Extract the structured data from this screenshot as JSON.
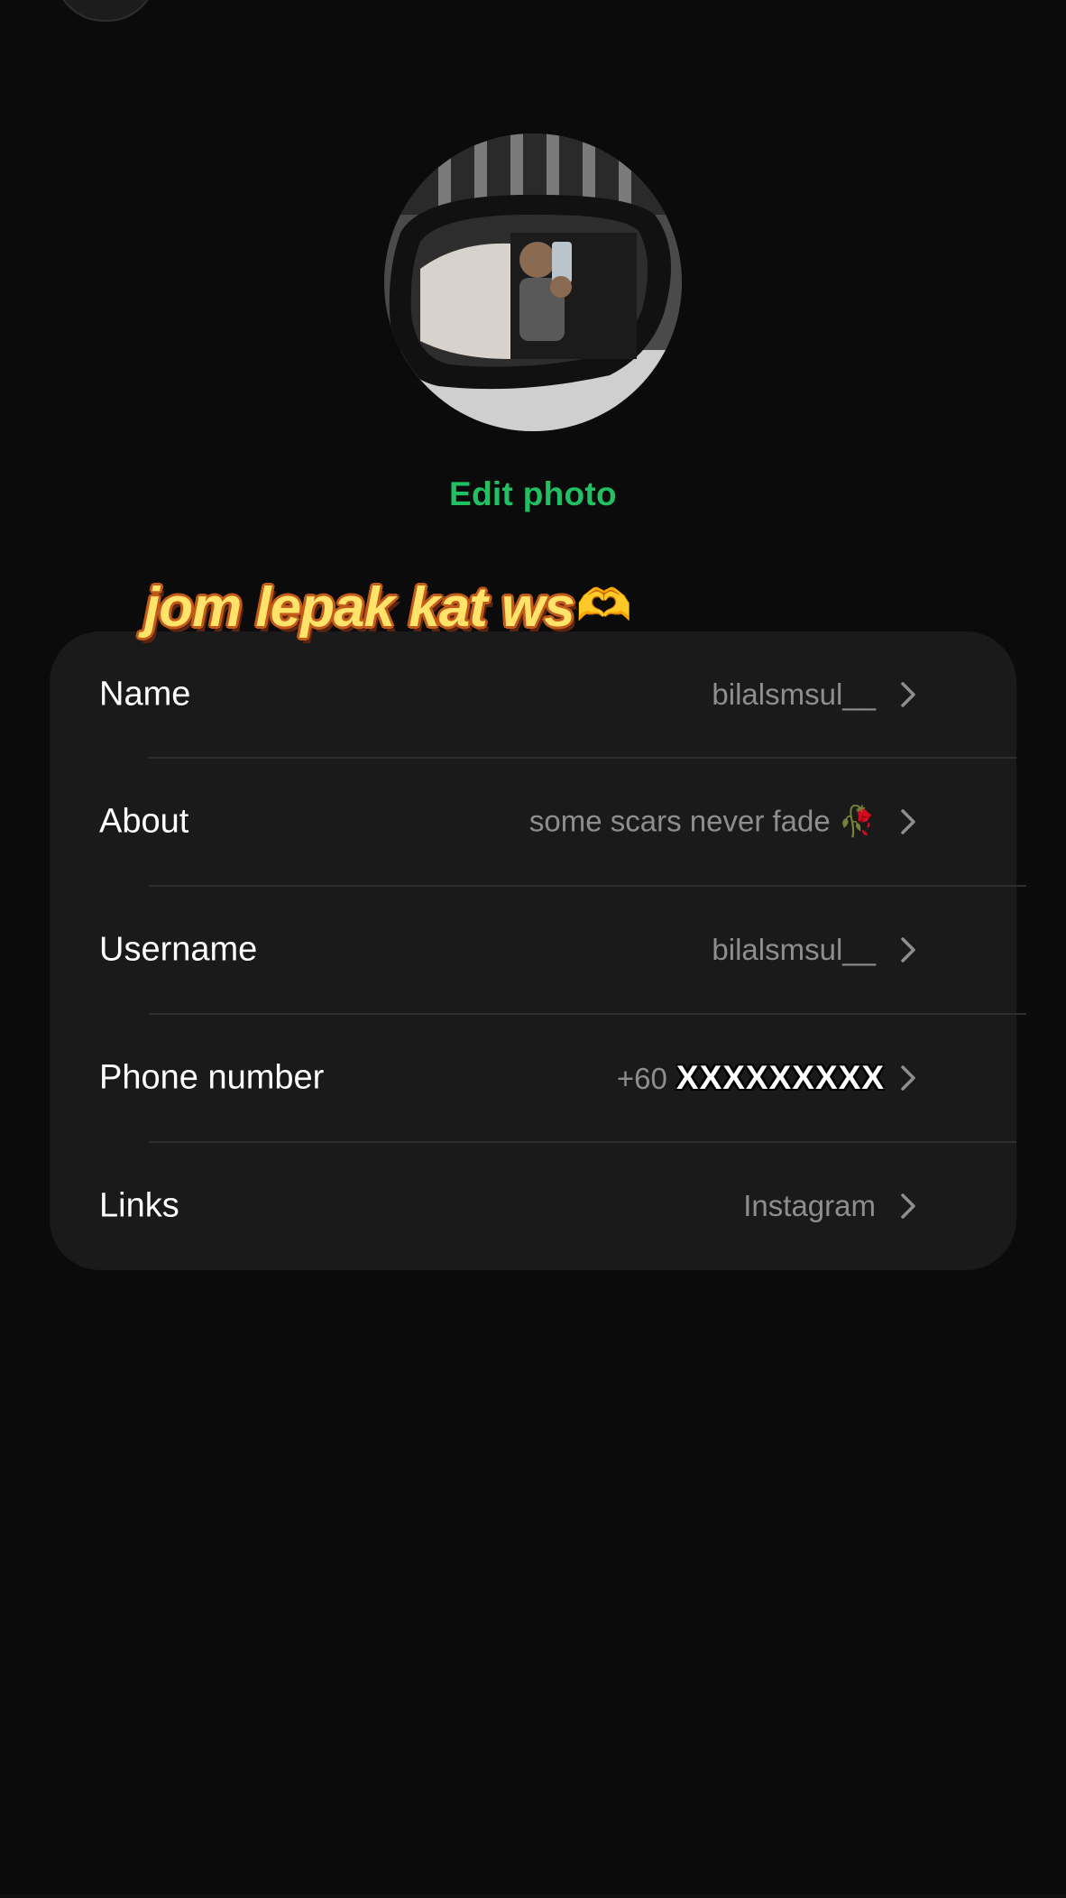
{
  "profile": {
    "edit_photo_label": "Edit photo",
    "sticker_text": "jom lepak kat ws",
    "sticker_emoji": "🫶"
  },
  "rows": [
    {
      "label": "Name",
      "value": "bilalsmsul__"
    },
    {
      "label": "About",
      "value": "some scars never fade 🥀"
    },
    {
      "label": "Username",
      "value": "bilalsmsul__"
    },
    {
      "label": "Phone number",
      "value_prefix": "+60",
      "value_redacted": "XXXXXXXXX"
    },
    {
      "label": "Links",
      "value": "Instagram"
    }
  ],
  "icons": {
    "chevron": "chevron-right-icon",
    "back": "back-icon"
  },
  "colors": {
    "accent": "#21c063",
    "background": "#0b0b0b",
    "card": "#1a1a1a"
  }
}
